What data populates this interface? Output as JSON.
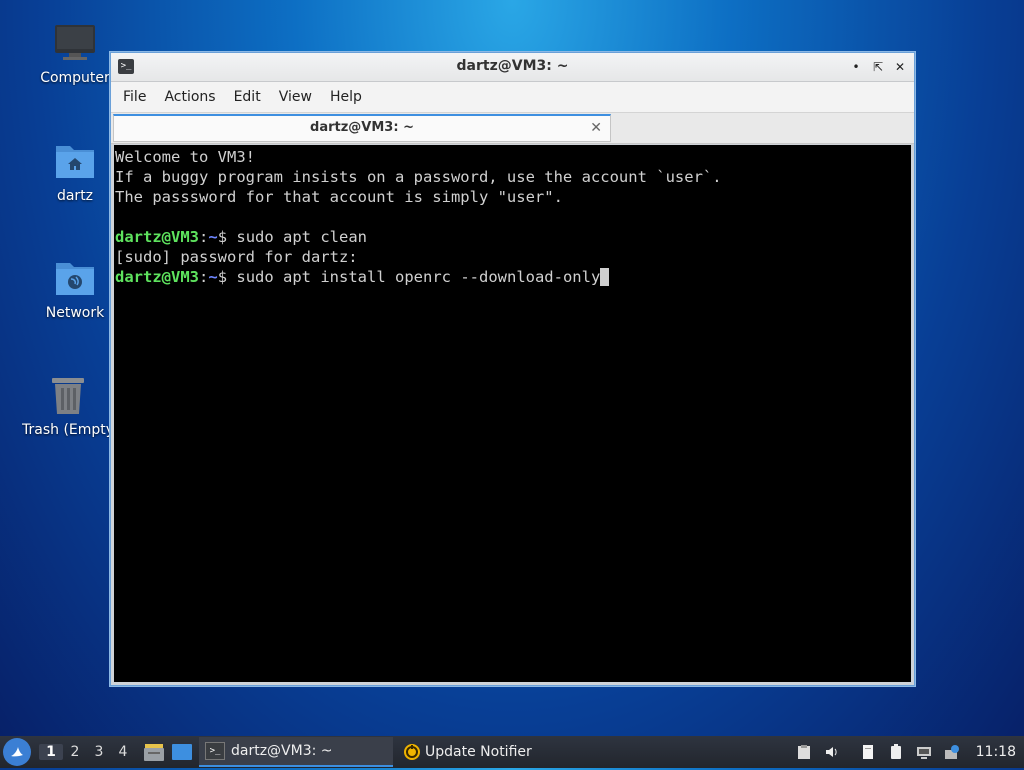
{
  "desktop": {
    "icons": [
      {
        "label": "Computer"
      },
      {
        "label": "dartz"
      },
      {
        "label": "Network"
      },
      {
        "label": "Trash (Empty)"
      }
    ]
  },
  "window": {
    "title": "dartz@VM3: ~",
    "menu": [
      "File",
      "Actions",
      "Edit",
      "View",
      "Help"
    ],
    "tab_title": "dartz@VM3: ~",
    "terminal": {
      "lines": [
        "Welcome to VM3!",
        "If a buggy program insists on a password, use the account `user`.",
        "The passsword for that account is simply \"user\"."
      ],
      "prompt_user": "dartz@VM3",
      "prompt_sep": ":",
      "prompt_path": "~",
      "prompt_end": "$ ",
      "cmd1": "sudo apt clean",
      "sudo_line": "[sudo] password for dartz:",
      "cmd2": "sudo apt install openrc --download-only"
    }
  },
  "taskbar": {
    "workspaces": [
      "1",
      "2",
      "3",
      "4"
    ],
    "active_workspace": "1",
    "tasks": [
      {
        "label": "dartz@VM3: ~",
        "icon": "terminal-icon"
      },
      {
        "label": "Update Notifier",
        "icon": "update-notifier-icon"
      }
    ],
    "clock": "11:18"
  },
  "colors": {
    "accent": "#3d8fe0",
    "prompt_user": "#5ee35e",
    "prompt_path": "#6f86ff"
  }
}
